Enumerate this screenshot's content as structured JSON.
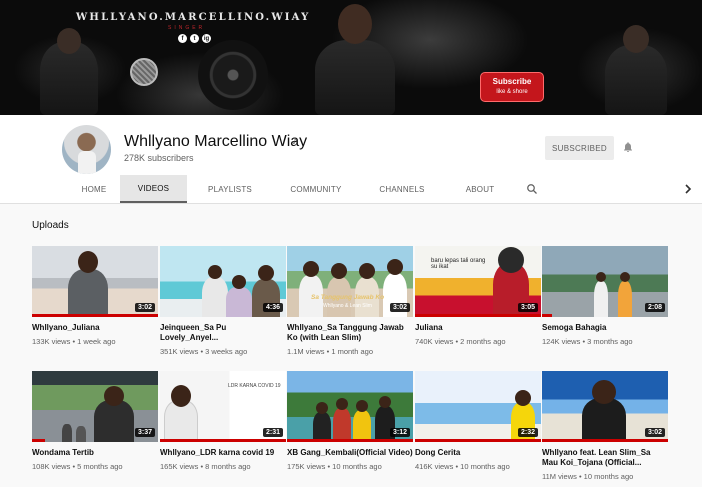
{
  "banner": {
    "title": "WHLLYANO.MARCELLINO.WIAY",
    "subtitle": "SINGER",
    "socials": [
      "f",
      "t",
      "ig"
    ],
    "cta_main": "Subscribe",
    "cta_sub": "like & shore"
  },
  "channel": {
    "name": "Whllyano Marcellino Wiay",
    "subscribers": "278K subscribers",
    "subscribe_button": "SUBSCRIBED"
  },
  "tabs": [
    {
      "label": "HOME"
    },
    {
      "label": "VIDEOS",
      "active": true
    },
    {
      "label": "PLAYLISTS"
    },
    {
      "label": "COMMUNITY"
    },
    {
      "label": "CHANNELS"
    },
    {
      "label": "ABOUT"
    }
  ],
  "section_title": "Uploads",
  "videos": [
    {
      "title": "Whllyano_Juliana",
      "views": "133K views",
      "age": "1 week ago",
      "duration": "3:02"
    },
    {
      "title": "Jeinqueen_Sa Pu Lovely_Anyel...",
      "views": "351K views",
      "age": "3 weeks ago",
      "duration": "4:36"
    },
    {
      "title": "Whllyano_Sa Tanggung Jawab Ko (with Lean Slim)",
      "views": "1.1M views",
      "age": "1 month ago",
      "duration": "3:02"
    },
    {
      "title": "Juliana",
      "views": "740K views",
      "age": "2 months ago",
      "duration": "3:05"
    },
    {
      "title": "Semoga Bahagia",
      "views": "124K views",
      "age": "3 months ago",
      "duration": "2:08"
    },
    {
      "title": "Wondama Tertib",
      "views": "108K views",
      "age": "5 months ago",
      "duration": "3:37"
    },
    {
      "title": "Whllyano_LDR karna covid 19",
      "views": "165K views",
      "age": "8 months ago",
      "duration": "2:31"
    },
    {
      "title": "XB Gang_Kembali(Official Video)",
      "views": "175K views",
      "age": "10 months ago",
      "duration": "3:12"
    },
    {
      "title": "Dong Cerita",
      "views": "416K views",
      "age": "10 months ago",
      "duration": "2:32"
    },
    {
      "title": "Whllyano feat. Lean Slim_Sa Mau Koi_Tojana (Official...",
      "views": "11M views",
      "age": "10 months ago",
      "duration": "3:02"
    }
  ],
  "thumb_texts": {
    "v3": "Sa Tanggung Jawab Ko",
    "v3b": "Whllyano & Lean Slim",
    "v4": "baru lepas tali orang su ikat",
    "v7": "LDR KARNA COVID 19"
  },
  "colors": {
    "accent": "#cc0000",
    "subscribed_bg": "#ececec",
    "page_bg": "#f9f9f9"
  }
}
